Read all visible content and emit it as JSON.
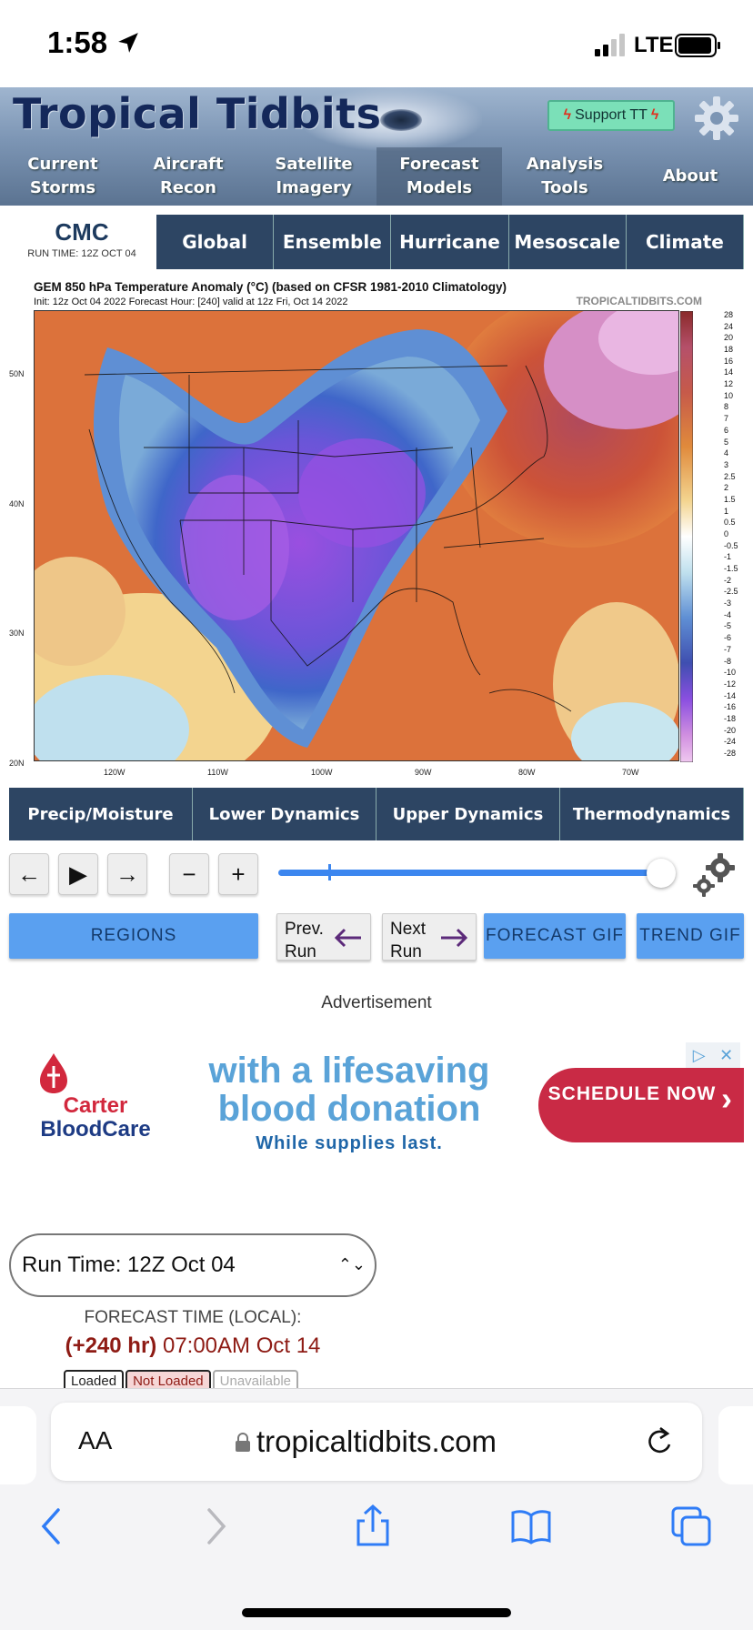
{
  "status_bar": {
    "time": "1:58",
    "network": "LTE"
  },
  "header": {
    "logo": "Tropical Tidbits",
    "support_label": "Support TT",
    "nav": [
      {
        "label": "Current\nStorms"
      },
      {
        "label": "Aircraft\nRecon"
      },
      {
        "label": "Satellite\nImagery"
      },
      {
        "label": "Forecast\nModels"
      },
      {
        "label": "Analysis Tools"
      },
      {
        "label": "About"
      }
    ]
  },
  "model": {
    "name": "CMC",
    "run_time": "RUN TIME: 12Z OCT 04",
    "tabs": [
      "Global",
      "Ensemble",
      "Hurricane",
      "Mesoscale",
      "Climate"
    ]
  },
  "map": {
    "title": "GEM 850 hPa Temperature Anomaly (°C) (based on CFSR 1981-2010 Climatology)",
    "subtitle": "Init: 12z Oct 04 2022   Forecast Hour: [240]   valid at 12z Fri, Oct 14 2022",
    "credit": "TROPICALTIDBITS.COM",
    "lat_labels": [
      "50N",
      "40N",
      "30N",
      "20N"
    ],
    "lon_labels": [
      "120W",
      "110W",
      "100W",
      "90W",
      "80W",
      "70W"
    ],
    "colorbar_labels": [
      "28",
      "24",
      "20",
      "18",
      "16",
      "14",
      "12",
      "10",
      "8",
      "7",
      "6",
      "5",
      "4",
      "3",
      "2.5",
      "2",
      "1.5",
      "1",
      "0.5",
      "0",
      "-0.5",
      "-1",
      "-1.5",
      "-2",
      "-2.5",
      "-3",
      "-4",
      "-5",
      "-6",
      "-7",
      "-8",
      "-10",
      "-12",
      "-14",
      "-16",
      "-18",
      "-20",
      "-24",
      "-28"
    ]
  },
  "categories": [
    "Precip/Moisture",
    "Lower Dynamics",
    "Upper Dynamics",
    "Thermodynamics"
  ],
  "controls": {
    "prev_frame": "←",
    "play": "▶",
    "next_frame": "→",
    "minus": "−",
    "plus": "+",
    "slider_position": 1.0,
    "regions": "REGIONS",
    "prev_run": "Prev.\nRun",
    "next_run": "Next\nRun",
    "forecast_gif": "FORECAST GIF",
    "trend_gif": "TREND GIF"
  },
  "ad": {
    "label": "Advertisement",
    "brand_line1": "Carter",
    "brand_line2": "BloodCare",
    "headline": "with a lifesaving blood donation",
    "subline": "While supplies last.",
    "cta": "SCHEDULE NOW"
  },
  "run_select": {
    "value": "Run Time: 12Z Oct 04",
    "forecast_label": "FORECAST TIME (LOCAL):",
    "forecast_hr": "(+240 hr)",
    "forecast_time": "07:00AM Oct 14",
    "legend": [
      "Loaded",
      "Not Loaded",
      "Unavailable"
    ]
  },
  "browser": {
    "aa": "AA",
    "url": "tropicaltidbits.com"
  },
  "colors": {
    "nav_dark": "#2d4563",
    "button_blue": "#5aa0f0",
    "forecast_red": "#8e1b14"
  }
}
